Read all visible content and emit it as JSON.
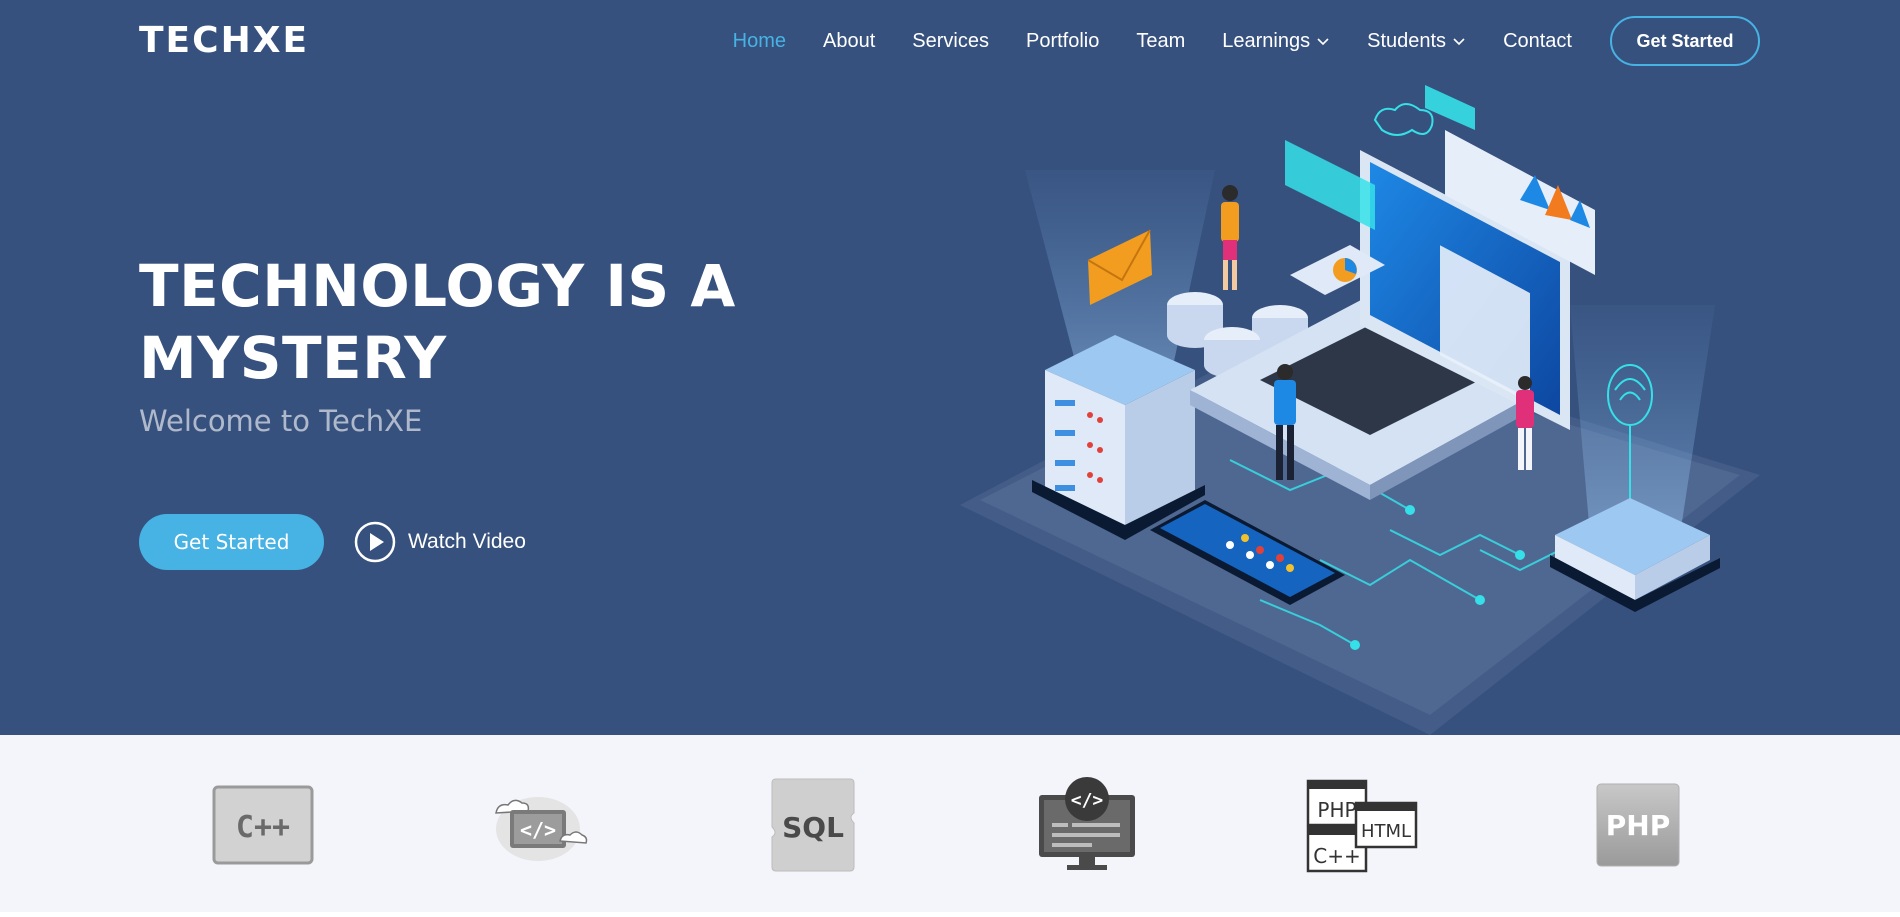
{
  "brand": {
    "logo": "TECHXE"
  },
  "nav": {
    "items": [
      {
        "label": "Home",
        "active": true,
        "dropdown": false
      },
      {
        "label": "About",
        "active": false,
        "dropdown": false
      },
      {
        "label": "Services",
        "active": false,
        "dropdown": false
      },
      {
        "label": "Portfolio",
        "active": false,
        "dropdown": false
      },
      {
        "label": "Team",
        "active": false,
        "dropdown": false
      },
      {
        "label": "Learnings",
        "active": false,
        "dropdown": true
      },
      {
        "label": "Students",
        "active": false,
        "dropdown": true
      },
      {
        "label": "Contact",
        "active": false,
        "dropdown": false
      }
    ],
    "cta_label": "Get Started"
  },
  "hero": {
    "title": "TECHNOLOGY IS A MYSTERY",
    "subtitle": "Welcome to TechXE",
    "primary_button": "Get Started",
    "video_link": "Watch Video",
    "illustration_icon": "isometric-tech-illustration-icon"
  },
  "clients": {
    "logos": [
      {
        "icon": "cpp-logo-icon",
        "text": "C++"
      },
      {
        "icon": "cloud-code-logo-icon",
        "text": "</>"
      },
      {
        "icon": "sql-logo-icon",
        "text": "SQL"
      },
      {
        "icon": "code-monitor-logo-icon",
        "text": "</>"
      },
      {
        "icon": "php-html-cpp-logo-icon",
        "texts": [
          "PHP",
          "HTML",
          "C++"
        ]
      },
      {
        "icon": "php-logo-icon",
        "text": "PHP"
      }
    ]
  },
  "colors": {
    "hero_bg": "#37517e",
    "accent": "#47b2e4",
    "strip_bg": "#f3f5fa"
  }
}
